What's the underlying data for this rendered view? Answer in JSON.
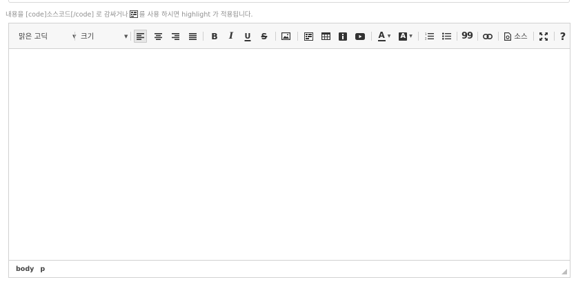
{
  "hint": {
    "prefix": "내용을 [code]소스코드[/code] 로 감싸거나",
    "suffix": "를 사용 하시면 highlight 가 적용됩니다."
  },
  "toolbar": {
    "font_family": "맑은 고딕",
    "font_size": "크기",
    "source_label": "소스",
    "help_label": "?",
    "bold_label": "B",
    "italic_label": "I",
    "underline_label": "U",
    "strike_label": "S",
    "text_color_label": "A",
    "bg_color_label": "A",
    "quote_label": "99"
  },
  "statusbar": {
    "path": [
      "body",
      "p"
    ]
  },
  "colors": {
    "toolbar_bg": "#f7f7f7",
    "border": "#d1d1d1",
    "hint_text": "#8f8f8f",
    "icon": "#333333"
  }
}
